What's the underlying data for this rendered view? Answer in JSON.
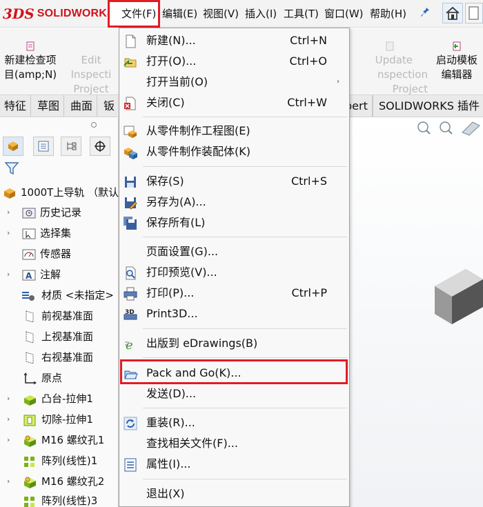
{
  "app": {
    "logo_mark": "3DS",
    "logo_text": "SOLIDWORKS"
  },
  "menubar": {
    "items": [
      "文件(F)",
      "编辑(E)",
      "视图(V)",
      "插入(I)",
      "工具(T)",
      "窗口(W)",
      "帮助(H)"
    ]
  },
  "ribbon": {
    "buttons": [
      {
        "label1": "新建检查项",
        "label2": "目(amp;N)",
        "enabled": true
      },
      {
        "label1": "Edit Inspecti",
        "label2": "Project",
        "enabled": false
      },
      {
        "label1": "Update",
        "label2": "nspection Project",
        "enabled": false
      },
      {
        "label1": "启动模板",
        "label2": "编辑器",
        "enabled": true
      }
    ]
  },
  "tabs": {
    "items": [
      "特征",
      "草图",
      "曲面",
      "钣",
      "pert",
      "SOLIDWORKS 插件"
    ]
  },
  "tree": {
    "root": "1000T上导轨 （默认",
    "items": [
      {
        "label": "历史记录",
        "expand": true
      },
      {
        "label": "选择集",
        "expand": true
      },
      {
        "label": "传感器",
        "expand": false
      },
      {
        "label": "注解",
        "expand": true
      },
      {
        "label": "材质 <未指定>",
        "expand": false
      },
      {
        "label": "前视基准面",
        "expand": false
      },
      {
        "label": "上视基准面",
        "expand": false
      },
      {
        "label": "右视基准面",
        "expand": false
      },
      {
        "label": "原点",
        "expand": false
      },
      {
        "label": "凸台-拉伸1",
        "expand": true
      },
      {
        "label": "切除-拉伸1",
        "expand": true
      },
      {
        "label": "M16 螺纹孔1",
        "expand": true
      },
      {
        "label": "阵列(线性)1",
        "expand": false
      },
      {
        "label": "M16 螺纹孔2",
        "expand": true
      },
      {
        "label": "阵列(线性)3",
        "expand": false
      }
    ]
  },
  "file_menu": {
    "items": [
      {
        "label": "新建(N)...",
        "shortcut": "Ctrl+N",
        "icon": "new-doc-icon"
      },
      {
        "label": "打开(O)...",
        "shortcut": "Ctrl+O",
        "icon": "open-icon"
      },
      {
        "label": "打开当前(O)",
        "shortcut": "",
        "icon": "",
        "submenu": "›"
      },
      {
        "label": "关闭(C)",
        "shortcut": "Ctrl+W",
        "icon": "close-doc-icon"
      },
      {
        "label": "从零件制作工程图(E)",
        "shortcut": "",
        "icon": "make-drawing-icon"
      },
      {
        "label": "从零件制作装配体(K)",
        "shortcut": "",
        "icon": "make-assembly-icon"
      },
      {
        "label": "保存(S)",
        "shortcut": "Ctrl+S",
        "icon": "save-icon"
      },
      {
        "label": "另存为(A)...",
        "shortcut": "",
        "icon": "save-as-icon"
      },
      {
        "label": "保存所有(L)",
        "shortcut": "",
        "icon": "save-all-icon"
      },
      {
        "label": "页面设置(G)...",
        "shortcut": "",
        "icon": ""
      },
      {
        "label": "打印预览(V)...",
        "shortcut": "",
        "icon": "print-preview-icon"
      },
      {
        "label": "打印(P)...",
        "shortcut": "Ctrl+P",
        "icon": "print-icon"
      },
      {
        "label": "Print3D...",
        "shortcut": "",
        "icon": "print3d-icon"
      },
      {
        "label": "出版到 eDrawings(B)",
        "shortcut": "",
        "icon": "edrawings-icon"
      },
      {
        "label": "Pack and Go(K)...",
        "shortcut": "",
        "icon": "pack-and-go-icon"
      },
      {
        "label": "发送(D)...",
        "shortcut": "",
        "icon": ""
      },
      {
        "label": "重装(R)...",
        "shortcut": "",
        "icon": "reload-icon"
      },
      {
        "label": "查找相关文件(F)...",
        "shortcut": "",
        "icon": ""
      },
      {
        "label": "属性(I)...",
        "shortcut": "",
        "icon": "properties-icon"
      },
      {
        "label": "退出(X)",
        "shortcut": "",
        "icon": ""
      }
    ]
  },
  "colors": {
    "highlight_red": "#e31b23",
    "brand_red": "#d1121b"
  }
}
